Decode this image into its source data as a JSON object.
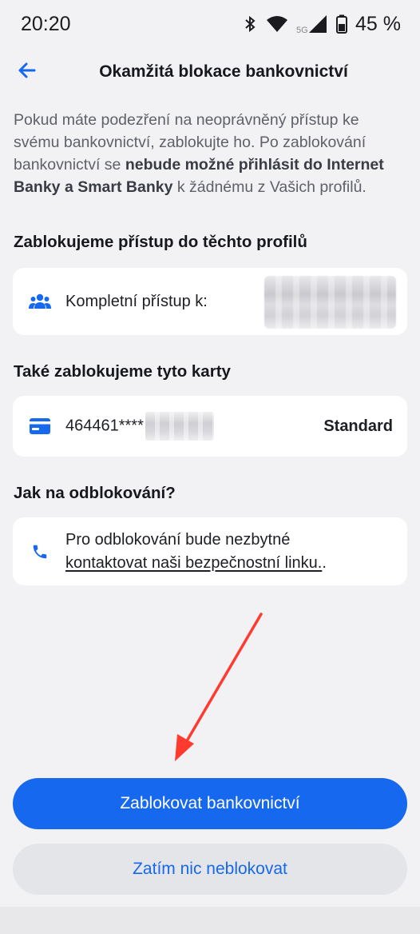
{
  "status_bar": {
    "time": "20:20",
    "network": "5G",
    "battery": "45 %"
  },
  "header": {
    "title": "Okamžitá blokace bankovnictví",
    "back_icon": "arrow-left-icon"
  },
  "intro": {
    "part1": "Pokud máte podezření na neoprávněný přístup ke svému bankovnictví, zablokujte ho. Po zablokování bankovnictví se ",
    "bold": "nebude možné přihlásit do Internet Banky a Smart Banky",
    "part2": " k žádnému z Vašich profilů."
  },
  "profiles_section": {
    "title": "Zablokujeme přístup do těchto profilů",
    "item_label": "Kompletní přístup k:",
    "item_icon": "users-icon"
  },
  "cards_section": {
    "title": "Také zablokujeme tyto karty",
    "card_number": "464461****",
    "card_type": "Standard",
    "card_icon": "credit-card-icon"
  },
  "unblock_section": {
    "title": "Jak na odblokování?",
    "text_line1": "Pro odblokování bude nezbytné",
    "link_text": "kontaktovat naši bezpečnostní linku.",
    "text_end": ".",
    "icon": "phone-icon"
  },
  "actions": {
    "primary_label": "Zablokovat bankovnictví",
    "secondary_label": "Zatím nic neblokovat"
  },
  "colors": {
    "accent": "#1668ee",
    "annotation": "#ff3b30",
    "background": "#f2f2f4"
  }
}
